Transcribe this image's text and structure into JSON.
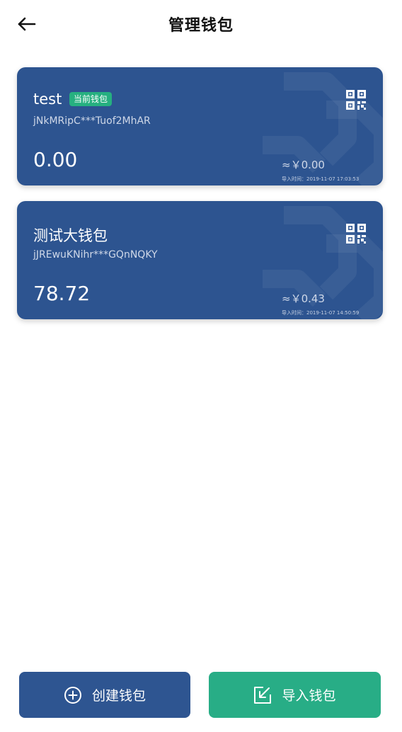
{
  "header": {
    "title": "管理钱包"
  },
  "wallets": [
    {
      "name": "test",
      "badge": "当前钱包",
      "address": "jNkMRipC***Tuof2MhAR",
      "balance": "0.00",
      "fiat": "≈￥0.00",
      "import_time": "导入时间：2019-11-07 17:03:53"
    },
    {
      "name": "测试大钱包",
      "address": "jJREwuKNihr***GQnNQKY",
      "balance": "78.72",
      "fiat": "≈￥0.43",
      "import_time": "导入时间：2019-11-07 14:50:59"
    }
  ],
  "actions": {
    "create_label": "创建钱包",
    "import_label": "导入钱包"
  },
  "colors": {
    "card": "#2d5490",
    "badge": "#26b080",
    "create_button": "#2e5591",
    "import_button": "#28ad86"
  },
  "icons": {
    "back": "arrow-left-icon",
    "qr": "qr-code-icon",
    "create": "plus-circle-icon",
    "import": "import-icon"
  }
}
